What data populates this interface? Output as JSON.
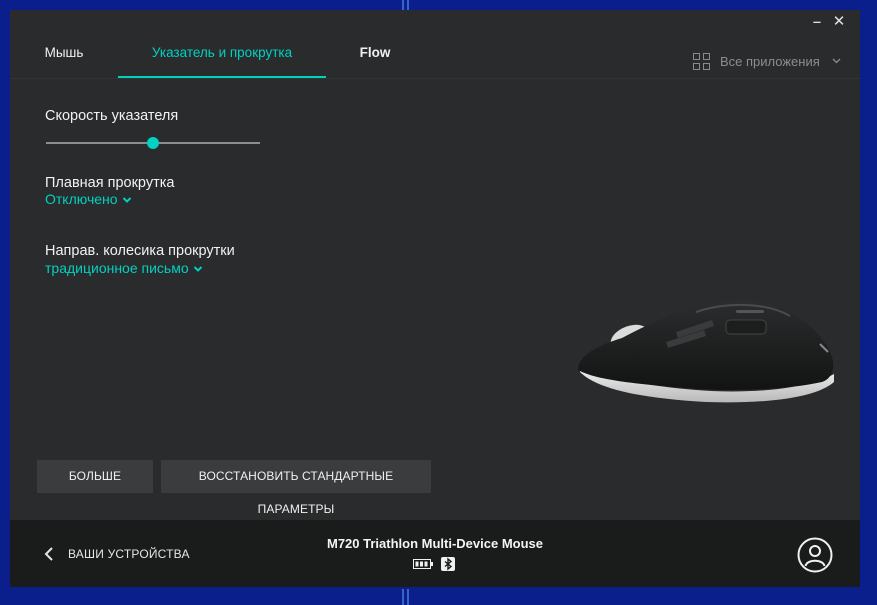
{
  "window": {
    "minimize_glyph": "‒",
    "close_glyph": "✕"
  },
  "tabs": [
    {
      "label": "Мышь",
      "active": false
    },
    {
      "label": "Указатель и прокрутка",
      "active": true
    },
    {
      "label": "Flow",
      "active": false
    }
  ],
  "apps_filter": {
    "label": "Все приложения",
    "icon": "grid-icon"
  },
  "settings": {
    "pointer_speed": {
      "label": "Скорость указателя",
      "value": 0.5
    },
    "smooth_scroll": {
      "label": "Плавная прокрутка",
      "value": "Отключено"
    },
    "scroll_direction": {
      "label": "Направ. колесика прокрутки",
      "value": "традиционное письмо"
    }
  },
  "buttons": {
    "more": "БОЛЬШЕ",
    "restore": "ВОССТАНОВИТЬ СТАНДАРТНЫЕ ПАРАМЕТРЫ"
  },
  "footer": {
    "back_label": "ВАШИ УСТРОЙСТВА",
    "device_name": "M720 Triathlon Multi-Device Mouse",
    "icons": [
      "battery-icon",
      "bluetooth-icon",
      "user-account-icon"
    ]
  },
  "colors": {
    "accent": "#00d1c1",
    "window_bg": "#2a2b2c",
    "footer_bg": "#1a1b1b",
    "desktop_bg": "#0a1e8c"
  }
}
